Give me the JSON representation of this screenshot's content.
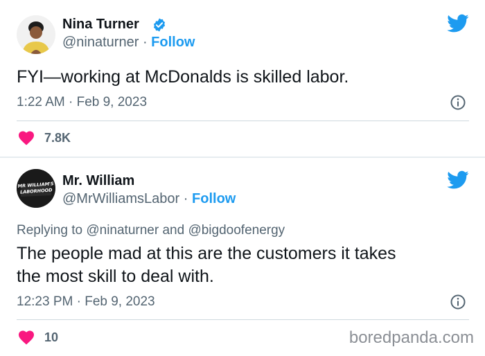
{
  "tweets": [
    {
      "name": "Nina Turner",
      "handle": "@ninaturner",
      "dot": "·",
      "follow": "Follow",
      "text": "FYI—working at McDonalds is skilled labor.",
      "time": "1:22 AM · Feb 9, 2023",
      "likes": "7.8K"
    },
    {
      "name": "Mr. William",
      "handle": "@MrWilliamsLabor",
      "dot": "·",
      "follow": "Follow",
      "avatar_text_1": "MR WILLIAM'S",
      "avatar_text_2": "LABORHOOD",
      "replying_prefix": "Replying to",
      "replying_to_1": "@ninaturner",
      "replying_and": "and",
      "replying_to_2": "@bigdoofenergy",
      "text_line1": "The people mad at this are the customers it takes",
      "text_line2": "the most skill to deal with.",
      "time": "12:23 PM · Feb 9, 2023",
      "likes": "10"
    }
  ],
  "watermark": "boredpanda.com",
  "colors": {
    "twitter_blue": "#1d9bf0",
    "heart": "#f91880",
    "muted": "#536471"
  },
  "icons": [
    "verified-badge-icon",
    "twitter-bird-icon",
    "info-icon",
    "heart-icon"
  ]
}
